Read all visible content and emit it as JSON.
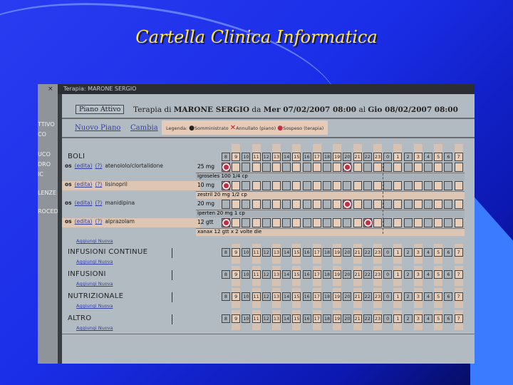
{
  "slide": {
    "title": "Cartella Clinica Informatica"
  },
  "window": {
    "title": "Terapia: MARONE SERGIO"
  },
  "sidebar": {
    "items": [
      "TTIVO",
      "CO",
      "UCO",
      "DRO",
      "IC",
      "LENZE",
      "ROCEDI"
    ]
  },
  "header": {
    "piano_attivo": "Piano Attivo",
    "terapia_prefix": "Terapia di",
    "patient": "MARONE SERGIO",
    "from_label": "da",
    "from_date": "Mer 07/02/2007 08:00",
    "to_label": "al",
    "to_date": "Gio 08/02/2007 08:00"
  },
  "toolbar": {
    "nuovo_piano": "Nuovo Piano",
    "cambia": "Cambia"
  },
  "legend": {
    "label": "Legenda:",
    "items": [
      "Somministrato",
      "Annullato (piano)",
      "Sospeso (terapia)"
    ]
  },
  "hours": [
    "8",
    "9",
    "10",
    "11",
    "12",
    "13",
    "14",
    "15",
    "16",
    "17",
    "18",
    "19",
    "20",
    "21",
    "22",
    "23",
    "0",
    "1",
    "2",
    "3",
    "4",
    "5",
    "6",
    "7"
  ],
  "sections": {
    "boli": {
      "title": "BOLI",
      "add": "Aggiungi Nuova",
      "therapies": [
        {
          "route": "os",
          "edit": "(edita)",
          "q": "(?)",
          "drug": "atenololo/clortalidone",
          "dose": "25 mg",
          "detail": "igroseles 100 1/4 cp",
          "scheduled": [
            "8",
            "20"
          ]
        },
        {
          "route": "os",
          "edit": "(edita)",
          "q": "(?)",
          "drug": "lisinopril",
          "dose": "10 mg",
          "detail": "zestril 20 mg 1/2 cp",
          "scheduled": [
            "8"
          ]
        },
        {
          "route": "os",
          "edit": "(edita)",
          "q": "(?)",
          "drug": "manidipina",
          "dose": "20 mg",
          "detail": "iperten 20 mg 1 cp",
          "scheduled": [
            "20"
          ]
        },
        {
          "route": "os",
          "edit": "(edita)",
          "q": "(?)",
          "drug": "alprazolam",
          "dose": "12 gtt",
          "detail": "xanax 12 gtt x 2 volte die",
          "scheduled": [
            "8",
            "22"
          ]
        }
      ]
    },
    "others": [
      {
        "title": "INFUSIONI CONTINUE",
        "add": "Aggiungi Nuova"
      },
      {
        "title": "INFUSIONI",
        "add": "Aggiungi Nuova"
      },
      {
        "title": "NUTRIZIONALE",
        "add": "Aggiungi Nuova"
      },
      {
        "title": "ALTRO",
        "add": "Aggiungi Nuova"
      }
    ]
  }
}
